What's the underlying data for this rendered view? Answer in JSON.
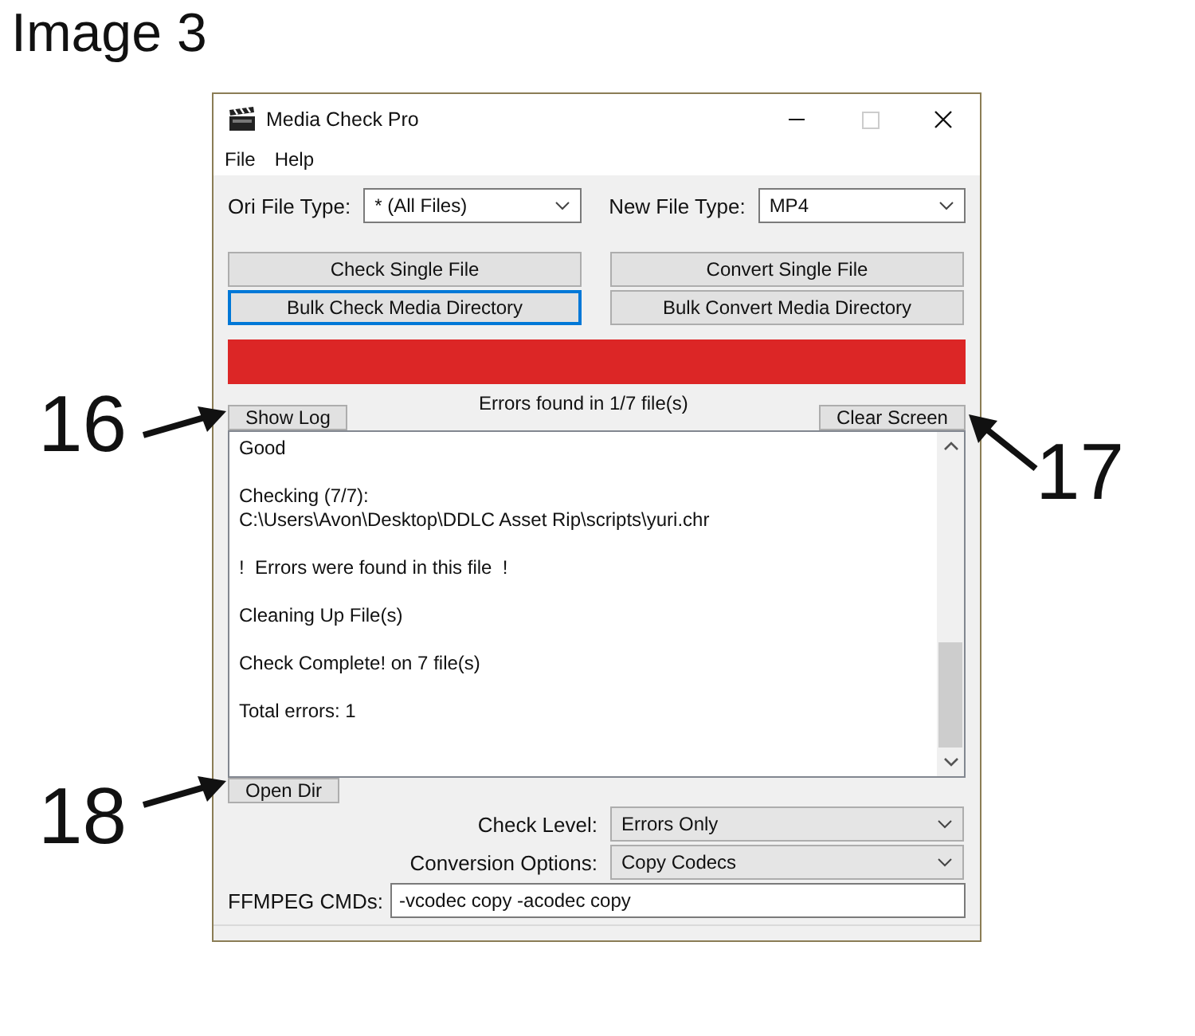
{
  "figure_title": "Image 3",
  "callouts": [
    {
      "label": "16",
      "kind": "left"
    },
    {
      "label": "17",
      "kind": "right"
    },
    {
      "label": "18",
      "kind": "left"
    }
  ],
  "window": {
    "title": "Media Check Pro"
  },
  "menu": [
    "File",
    "Help"
  ],
  "ori_file_type": {
    "label": "Ori File Type:",
    "value": "* (All Files)"
  },
  "new_file_type": {
    "label": "New File Type:",
    "value": "MP4"
  },
  "buttons": [
    {
      "label": "Check Single File",
      "focused": false
    },
    {
      "label": "Convert Single File",
      "focused": false
    },
    {
      "label": "Bulk Check Media Directory",
      "focused": true
    },
    {
      "label": "Bulk Convert Media Directory",
      "focused": false
    }
  ],
  "progress": {
    "level": 1,
    "color": "#dc2626"
  },
  "status_text": "Errors found in 1/7 file(s)",
  "show_log_button": "Show Log",
  "clear_screen_button": "Clear Screen",
  "log": [
    [
      "Good"
    ],
    [
      "Checking (7/7):",
      "C:\\Users\\Avon\\Desktop\\DDLC Asset Rip\\scripts\\yuri.chr"
    ],
    [
      "!  Errors were found in this file  !"
    ],
    [
      "Cleaning Up File(s)"
    ],
    [
      "Check Complete! on 7 file(s)"
    ],
    [
      "Total errors: 1"
    ]
  ],
  "open_dir_button": "Open Dir",
  "check_level": {
    "label": "Check Level:",
    "value": "Errors Only"
  },
  "conversion_options": {
    "label": "Conversion Options:",
    "value": "Copy Codecs"
  },
  "ffmpeg_cmds": {
    "label": "FFMPEG CMDs:",
    "value": "-vcodec copy -acodec copy"
  }
}
